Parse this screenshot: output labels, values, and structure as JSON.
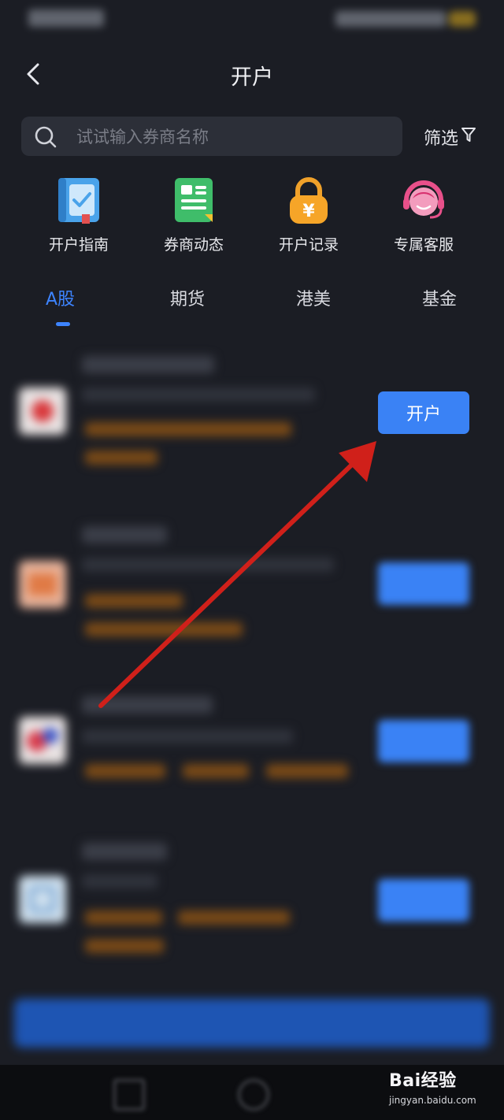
{
  "header": {
    "title": "开户"
  },
  "search": {
    "placeholder": "试试输入券商名称"
  },
  "filter": {
    "label": "筛选"
  },
  "quick_actions": [
    {
      "label": "开户指南",
      "icon": "guide-book-icon"
    },
    {
      "label": "券商动态",
      "icon": "news-icon"
    },
    {
      "label": "开户记录",
      "icon": "lock-yuan-icon"
    },
    {
      "label": "专属客服",
      "icon": "customer-service-icon"
    }
  ],
  "tabs": [
    {
      "label": "A股",
      "active": true
    },
    {
      "label": "期货"
    },
    {
      "label": "港美"
    },
    {
      "label": "基金"
    }
  ],
  "list": {
    "first_button_label": "开户"
  },
  "colors": {
    "background": "#1b1d24",
    "accent": "#3d84ff",
    "button": "#3a82f5",
    "arrow": "#d0201a"
  },
  "watermark": {
    "brand": "Bai经验",
    "url": "jingyan.baidu.com"
  }
}
